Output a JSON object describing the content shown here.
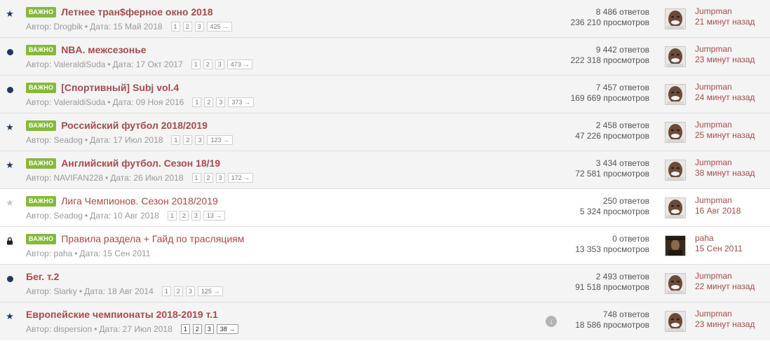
{
  "badge_label": "ВАЖНО",
  "meta_author_prefix": "Автор:",
  "meta_date_prefix": "Дата:",
  "meta_separator": "•",
  "topics": [
    {
      "status": "star",
      "bold": true,
      "badge": true,
      "title": "Летнее тран$ферное окно 2018",
      "author": "Drogbik",
      "date": "15 Май 2018",
      "pages": [
        "1",
        "2",
        "3"
      ],
      "last_page": "425 →",
      "pages_dark": false,
      "replies": "8 486 ответов",
      "views": "236 210 просмотров",
      "last_user": "Jumpman",
      "last_time": "21 минут назад",
      "avatar": "avatar-jumpman",
      "download": false
    },
    {
      "status": "dot",
      "bold": true,
      "badge": true,
      "title": "NBA. межсезонье",
      "author": "ValeraldiSuda",
      "date": "17 Окт 2017",
      "pages": [
        "1",
        "2",
        "3"
      ],
      "last_page": "473 →",
      "pages_dark": false,
      "replies": "9 442 ответов",
      "views": "222 318 просмотров",
      "last_user": "Jumpman",
      "last_time": "23 минут назад",
      "avatar": "avatar-jumpman",
      "download": false
    },
    {
      "status": "dot",
      "bold": true,
      "badge": true,
      "title": "[Спортивный] Subj vol.4",
      "author": "ValeraldiSuda",
      "date": "09 Ноя 2016",
      "pages": [
        "1",
        "2",
        "3"
      ],
      "last_page": "373 →",
      "pages_dark": false,
      "replies": "7 457 ответов",
      "views": "169 669 просмотров",
      "last_user": "Jumpman",
      "last_time": "24 минут назад",
      "avatar": "avatar-jumpman",
      "download": false
    },
    {
      "status": "star",
      "bold": true,
      "badge": true,
      "title": "Российский футбол 2018/2019",
      "author": "Seadog",
      "date": "17 Июл 2018",
      "pages": [
        "1",
        "2",
        "3"
      ],
      "last_page": "123 →",
      "pages_dark": false,
      "replies": "2 458 ответов",
      "views": "47 226 просмотров",
      "last_user": "Jumpman",
      "last_time": "25 минут назад",
      "avatar": "avatar-jumpman",
      "download": false
    },
    {
      "status": "star",
      "bold": true,
      "badge": true,
      "title": "Английский футбол. Сезон 18/19",
      "author": "NAVIFAN228",
      "date": "26 Июл 2018",
      "pages": [
        "1",
        "2",
        "3"
      ],
      "last_page": "172 →",
      "pages_dark": false,
      "replies": "3 434 ответов",
      "views": "72 581 просмотров",
      "last_user": "Jumpman",
      "last_time": "38 минут назад",
      "avatar": "avatar-jumpman",
      "download": false
    },
    {
      "status": "star-empty",
      "bold": false,
      "badge": true,
      "title": "Лига Чемпионов. Сезон 2018/2019",
      "author": "Seadog",
      "date": "10 Авг 2018",
      "pages": [
        "1",
        "2",
        "3"
      ],
      "last_page": "13 →",
      "pages_dark": false,
      "replies": "250 ответов",
      "views": "5 324 просмотров",
      "last_user": "Jumpman",
      "last_time": "16 Авг 2018",
      "avatar": "avatar-jumpman",
      "download": false
    },
    {
      "status": "lock",
      "bold": false,
      "badge": true,
      "title": "Правила раздела + Гайд по трасляциям",
      "author": "paha",
      "date": "15 Сен 2011",
      "pages": [],
      "last_page": "",
      "pages_dark": false,
      "replies": "0 ответов",
      "views": "13 353 просмотров",
      "last_user": "paha",
      "last_time": "15 Сен 2011",
      "avatar": "avatar-paha",
      "download": false
    },
    {
      "status": "dot",
      "bold": true,
      "badge": false,
      "title": "Бег. т.2",
      "author": "Slarky",
      "date": "18 Авг 2014",
      "pages": [
        "1",
        "2",
        "3"
      ],
      "last_page": "125 →",
      "pages_dark": false,
      "replies": "2 493 ответов",
      "views": "91 518 просмотров",
      "last_user": "Jumpman",
      "last_time": "22 минут назад",
      "avatar": "avatar-jumpman",
      "download": false
    },
    {
      "status": "star",
      "bold": true,
      "badge": false,
      "title": "Европейские чемпионаты 2018-2019 т.1",
      "author": "dispersion",
      "date": "27 Июл 2018",
      "pages": [
        "1",
        "2",
        "3"
      ],
      "last_page": "38 →",
      "pages_dark": true,
      "replies": "748 ответов",
      "views": "18 586 просмотров",
      "last_user": "Jumpman",
      "last_time": "23 минут назад",
      "avatar": "avatar-jumpman",
      "download": true
    }
  ],
  "colors": {
    "row_bg": "#f4f4f4",
    "row_bg_plain": "#ffffff",
    "title": "#a64b4b",
    "badge": "#86b83d",
    "meta": "#9a9a9a",
    "star": "#1f3a5f"
  }
}
